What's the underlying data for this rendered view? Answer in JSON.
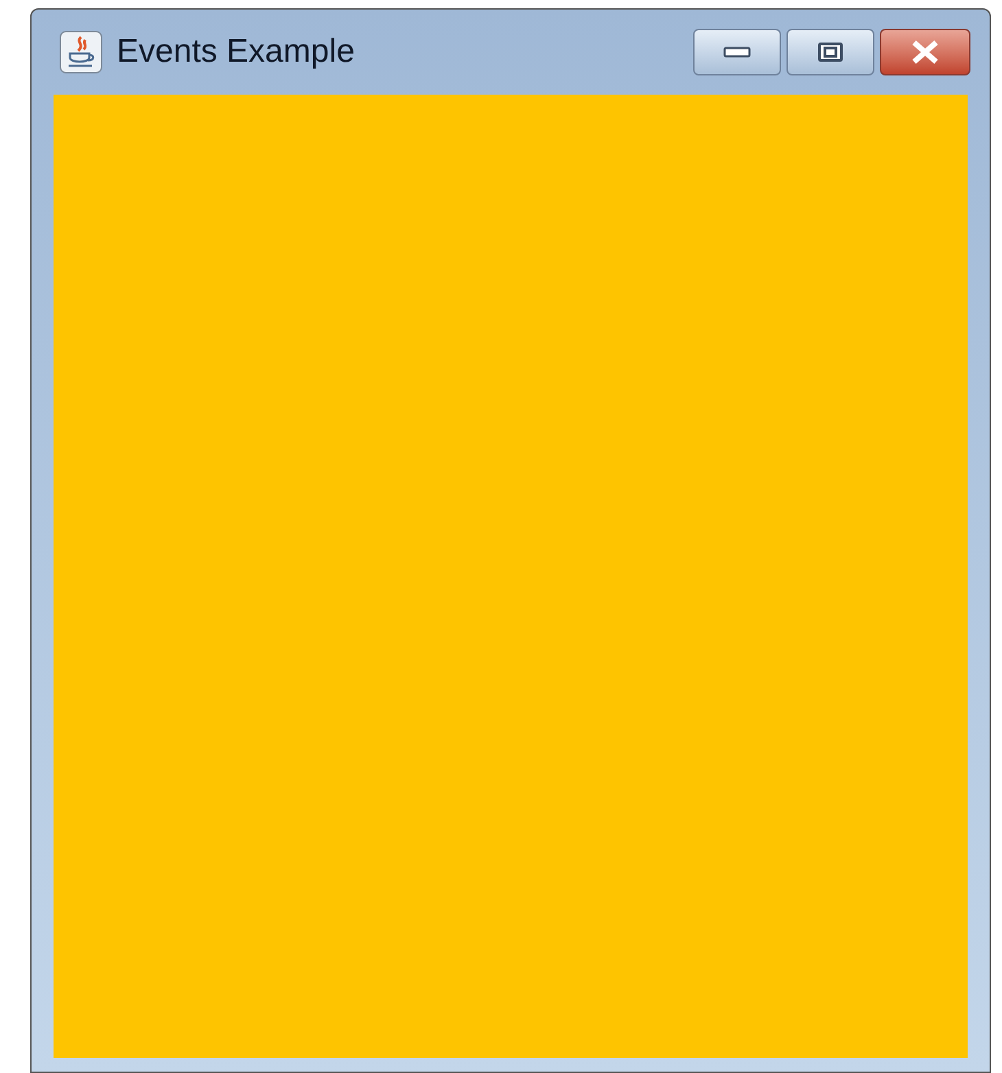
{
  "window": {
    "title": "Events Example"
  },
  "panel": {
    "color": "#fec400"
  }
}
